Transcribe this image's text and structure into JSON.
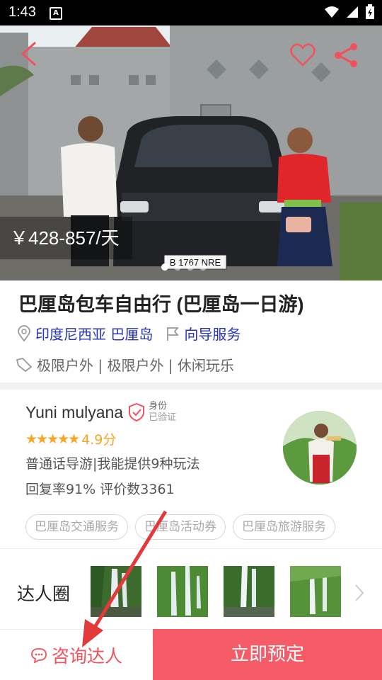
{
  "status_bar": {
    "time": "1:43",
    "notification_icon": "A"
  },
  "hero": {
    "price": "￥428-857/天",
    "icons": [
      "back-arrow-icon",
      "heart-icon",
      "share-icon"
    ],
    "carousel_dots": 4,
    "active_dot": 0,
    "photo_plate": "B 1767 NRE"
  },
  "product": {
    "title": "巴厘岛包车自由行 (巴厘岛一日游)",
    "location": "印度尼西亚 巴厘岛",
    "service": "向导服务",
    "tags": "极限户外 | 极限户外 | 休闲玩乐"
  },
  "guide": {
    "name": "Yuni mulyana",
    "verify_title": "身份",
    "verify_sub": "已验证",
    "stars": "★★★★★",
    "rating": "4.9分",
    "intro": "普通话导游|我能提供9种玩法",
    "stats": "回复率91% 评价数3361",
    "chips": [
      "巴厘岛交通服务",
      "巴厘岛活动券",
      "巴厘岛旅游服务"
    ]
  },
  "circle": {
    "label": "达人圈",
    "thumb_count": 4
  },
  "bottom_bar": {
    "consult": "咨询达人",
    "book": "立即预定"
  },
  "colors": {
    "accent": "#f65c67",
    "link": "#2634b5",
    "star": "#f5a623"
  }
}
